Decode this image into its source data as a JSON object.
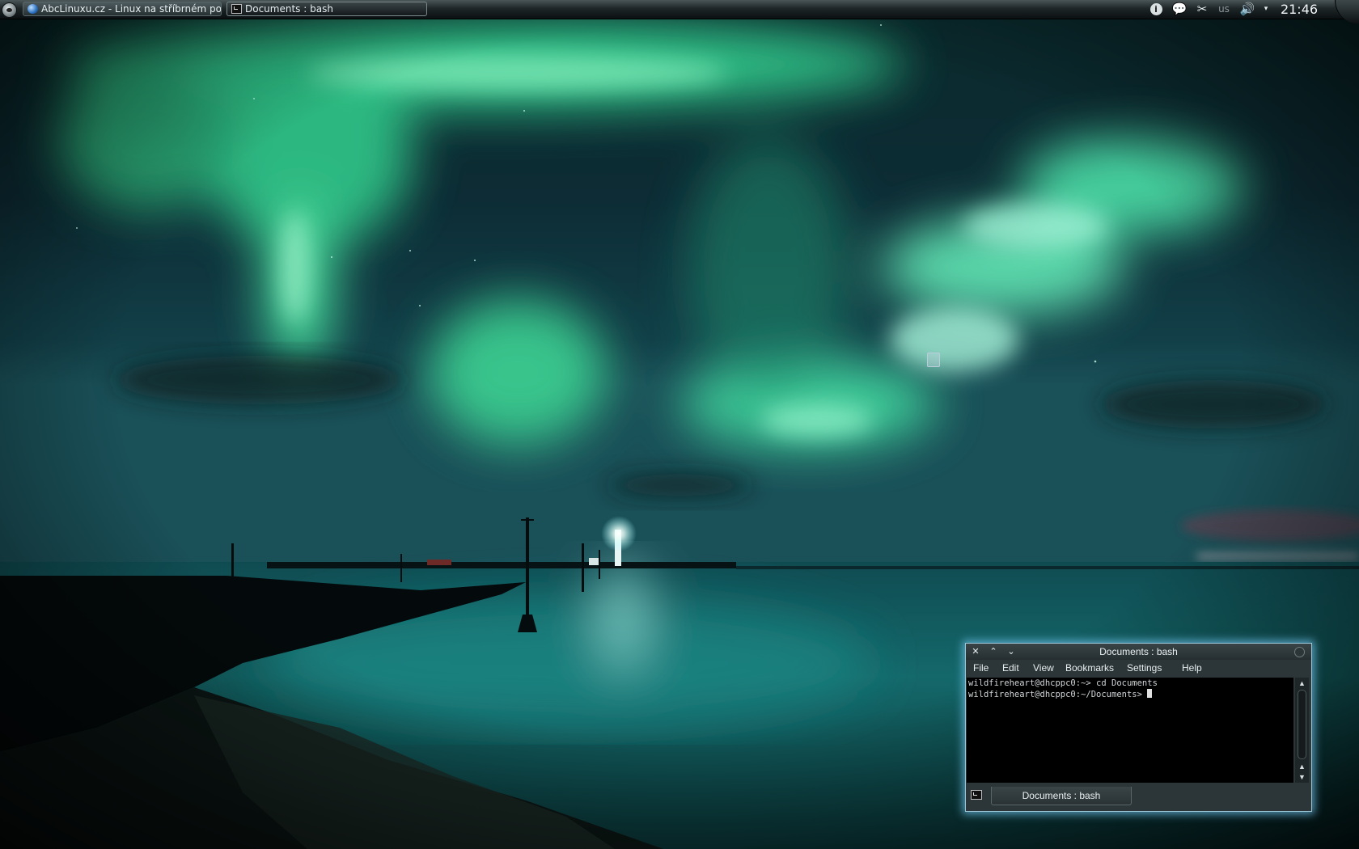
{
  "panel": {
    "tasks": [
      {
        "label": "AbcLinuxu.cz - Linux na stříbrném podn",
        "icon": "browser-globe-icon",
        "active": false
      },
      {
        "label": "Documents : bash",
        "icon": "terminal-icon",
        "active": true
      }
    ],
    "tray": {
      "info_glyph": "i",
      "chat_glyph": "💬",
      "cut_glyph": "✂",
      "keyboard_layout": "us",
      "volume_glyph": "🔊",
      "arrow_glyph": "▾"
    },
    "clock": "21:46"
  },
  "konsole": {
    "title": "Documents : bash",
    "buttons": {
      "close": "✕",
      "minimize": "⌃",
      "maximize": "⌄"
    },
    "menu": [
      "File",
      "Edit",
      "View",
      "Bookmarks",
      "Settings",
      "Help"
    ],
    "terminal_lines": [
      "wildfireheart@dhcppc0:~> cd Documents",
      "wildfireheart@dhcppc0:~/Documents> "
    ],
    "scroll_arrows": {
      "up": "▲",
      "down": "▼"
    },
    "tab_label": "Documents : bash"
  },
  "colors": {
    "aurora": "#3ed9a0",
    "window_glow": "#6ebee6",
    "panel": "#1e2628"
  }
}
